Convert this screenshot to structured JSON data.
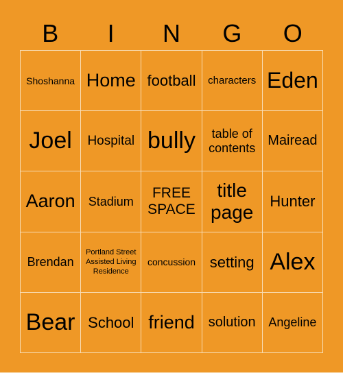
{
  "header": [
    "B",
    "I",
    "N",
    "G",
    "O"
  ],
  "grid": [
    [
      "Shoshanna",
      "Home",
      "football",
      "characters",
      "Eden"
    ],
    [
      "Joel",
      "Hospital",
      "bully",
      "table of contents",
      "Mairead"
    ],
    [
      "Aaron",
      "Stadium",
      "FREE SPACE",
      "title page",
      "Hunter"
    ],
    [
      "Brendan",
      "Portland Street Assisted Living Residence",
      "concussion",
      "setting",
      "Alex"
    ],
    [
      "Bear",
      "School",
      "friend",
      "solution",
      "Angeline"
    ]
  ],
  "colors": {
    "background": "#EF9826",
    "grid_line": "#F8DDB5",
    "text": "#000000"
  }
}
